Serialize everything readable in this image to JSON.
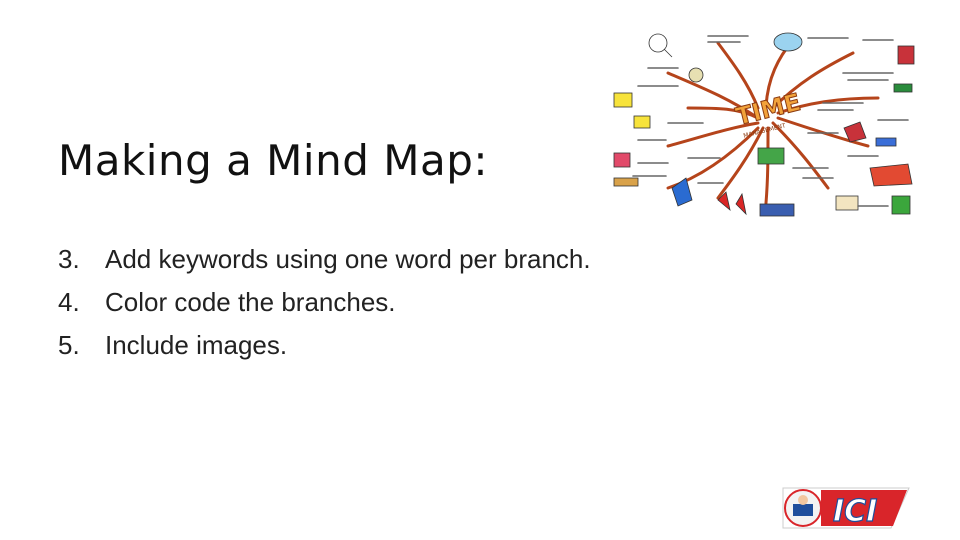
{
  "slide": {
    "title": "Making a Mind Map:",
    "items": [
      {
        "number": "3.",
        "text": "Add keywords using one word per branch."
      },
      {
        "number": "4.",
        "text": "Color code the branches."
      },
      {
        "number": "5.",
        "text": "Include images."
      }
    ]
  },
  "mindmap_image": {
    "center_text": "TIME",
    "center_subtext": "MANAGEMENT"
  },
  "logo": {
    "text": "ICI",
    "colors": {
      "red": "#d9252a",
      "blue": "#1f4e9c"
    }
  }
}
